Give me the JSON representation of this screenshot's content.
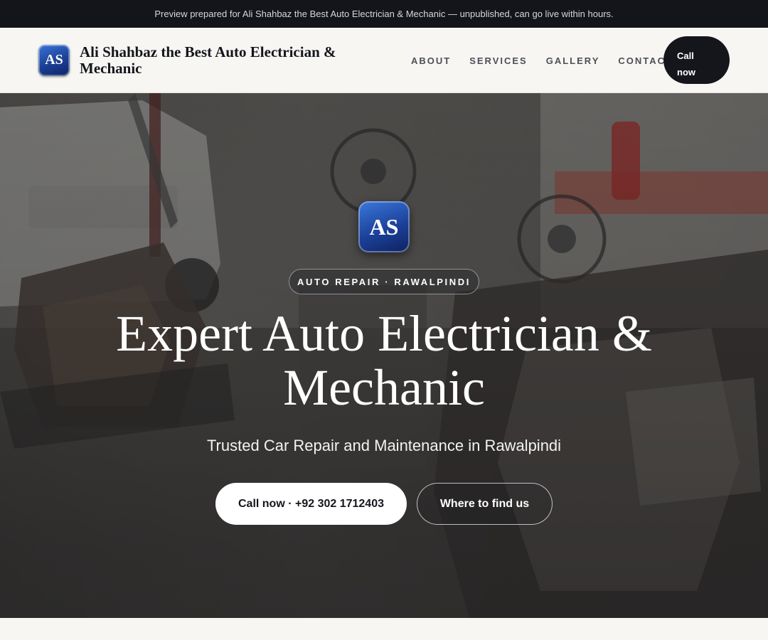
{
  "preview_bar": {
    "text": "Preview prepared for Ali Shahbaz the Best Auto Electrician & Mechanic — unpublished, can go live within hours."
  },
  "header": {
    "logo_text": "AS",
    "brand_name": "Ali Shahbaz the Best Auto Electrician & Mechanic",
    "nav": [
      {
        "label": "ABOUT"
      },
      {
        "label": "SERVICES"
      },
      {
        "label": "GALLERY"
      },
      {
        "label": "CONTACT"
      }
    ],
    "call_label_line1": "Call",
    "call_label_line2": "now"
  },
  "hero": {
    "logo_text": "AS",
    "eyebrow": "AUTO REPAIR · RAWALPINDI",
    "title_line1": "Expert Auto Electrician &",
    "title_line2": "Mechanic",
    "subtitle": "Trusted Car Repair and Maintenance in Rawalpindi",
    "primary_cta": "Call now · +92 302 1712403",
    "secondary_cta": "Where to find us",
    "background": "workshop-photo"
  },
  "colors": {
    "dark": "#13151b",
    "accent_blue": "#1b3f95",
    "page_bg": "#f7f6f2"
  }
}
